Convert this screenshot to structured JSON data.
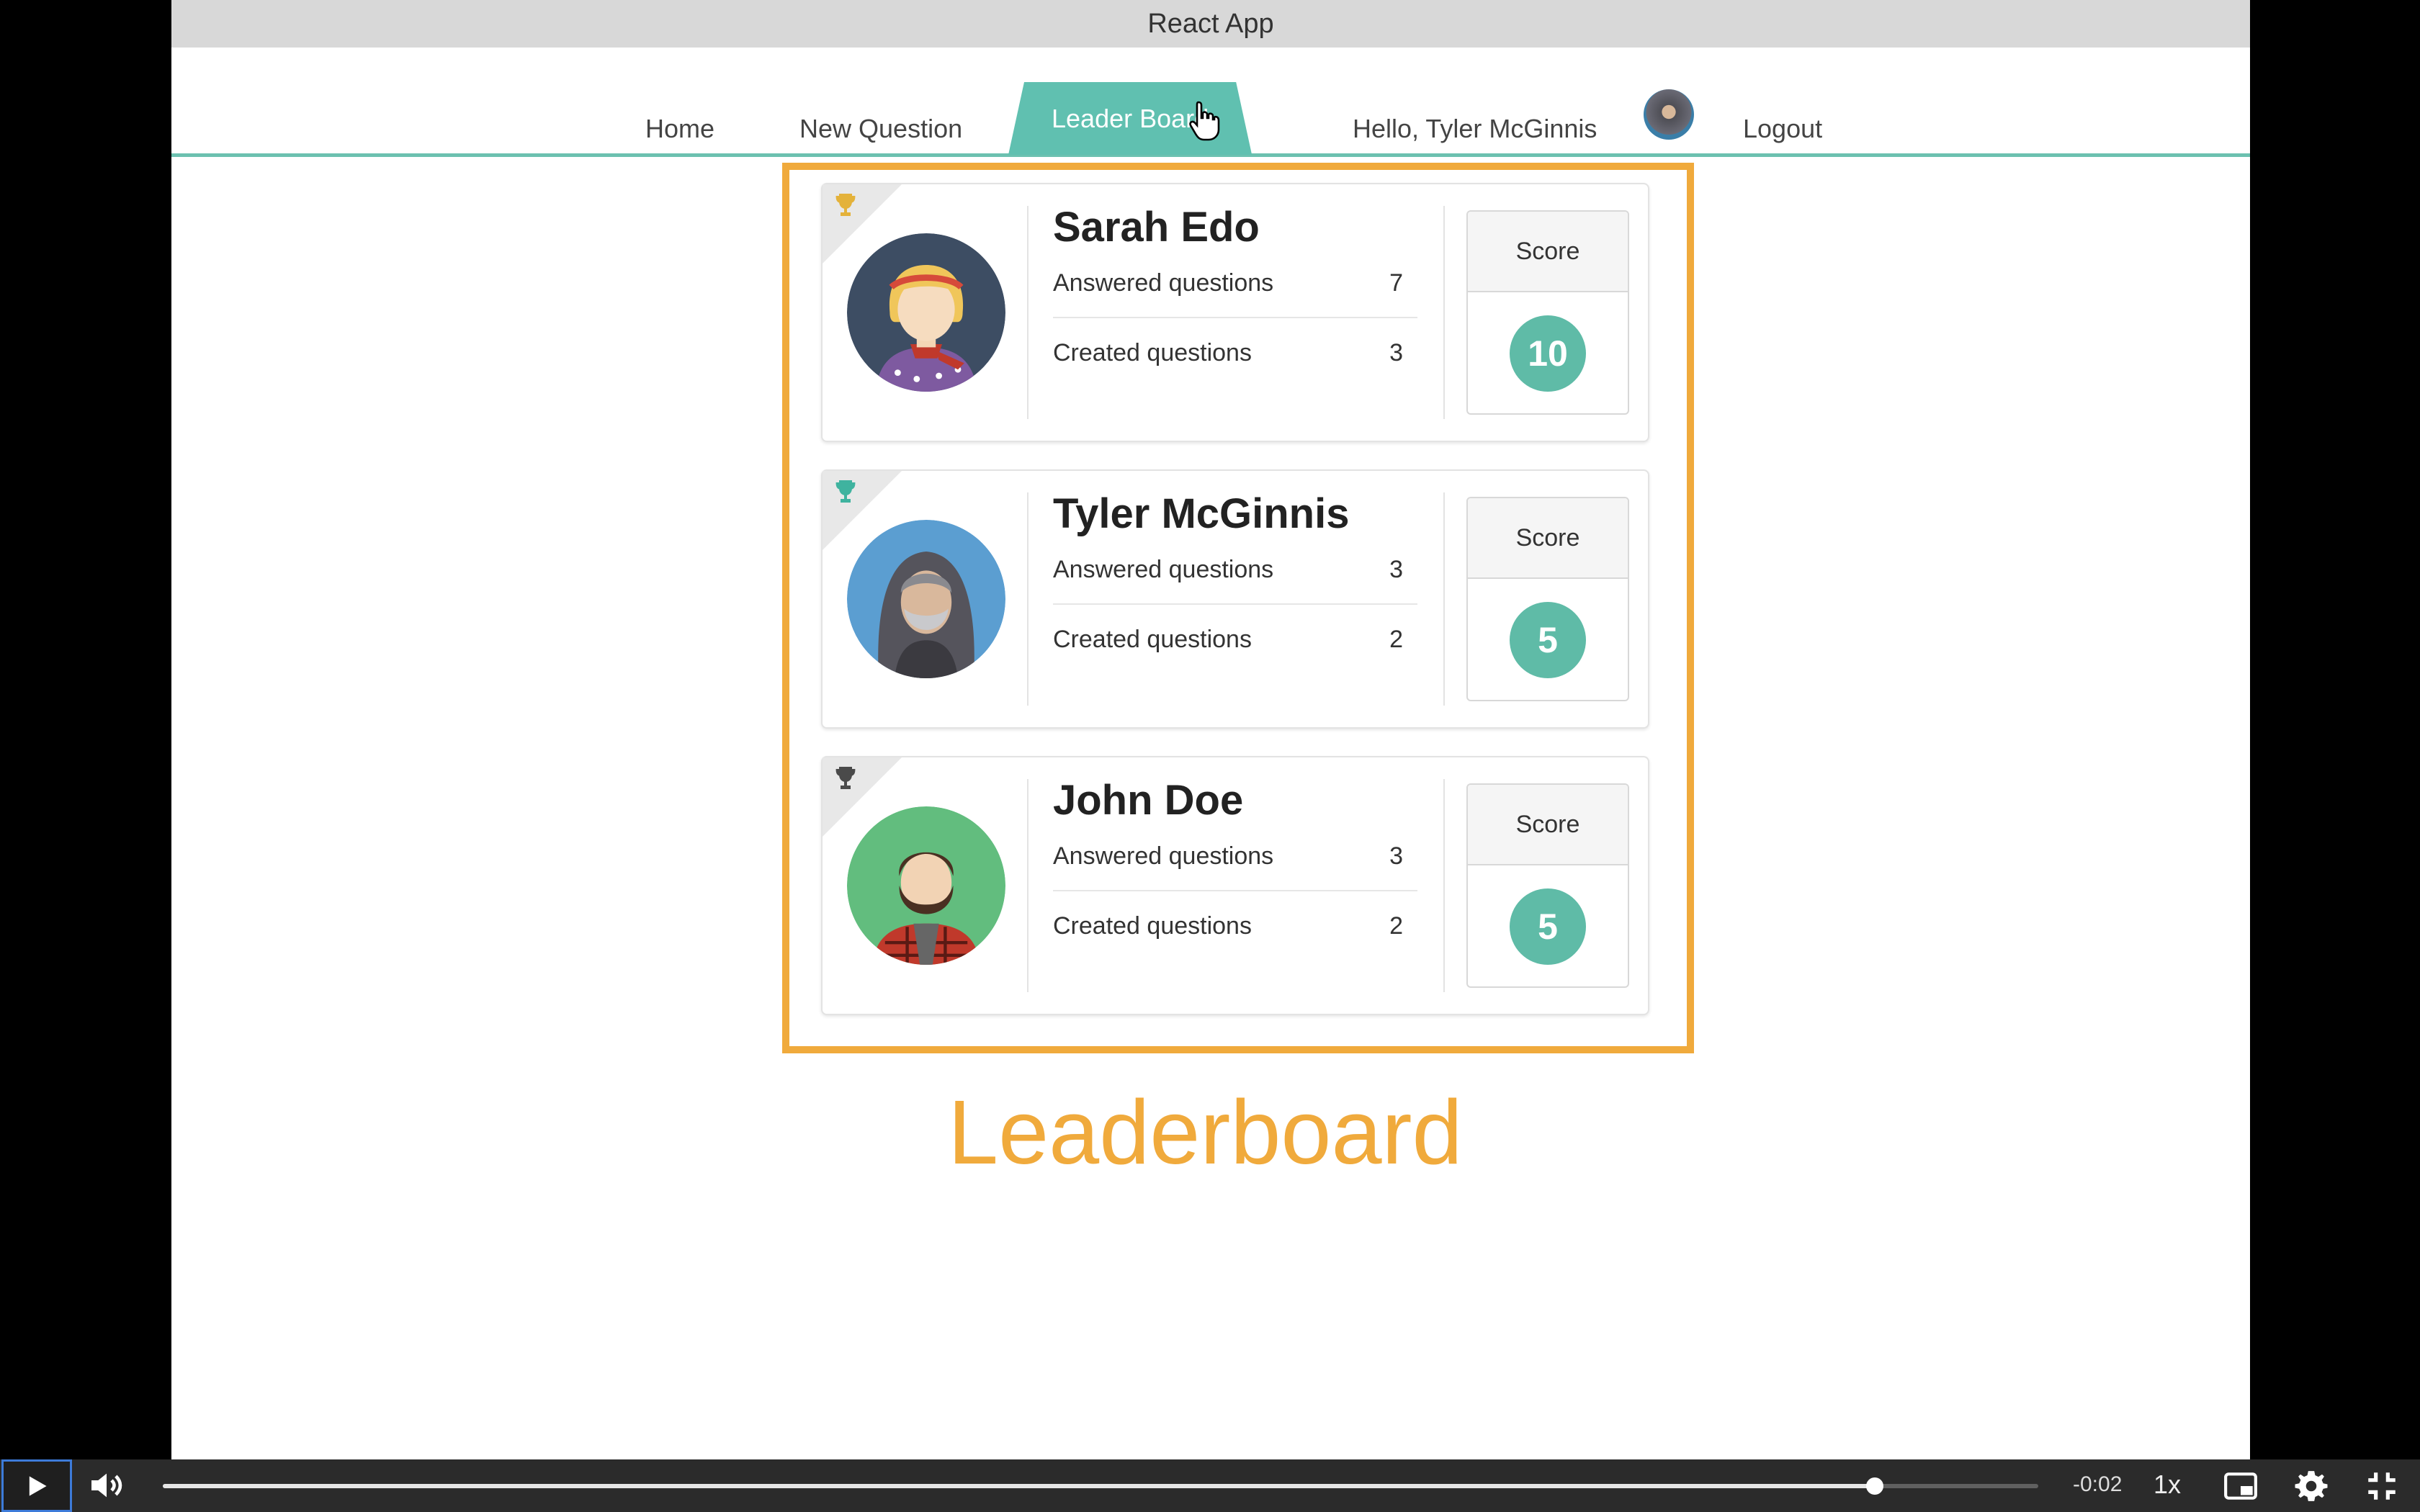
{
  "window": {
    "title": "React App"
  },
  "nav": {
    "items": [
      {
        "label": "Home"
      },
      {
        "label": "New Question"
      },
      {
        "label": "Leader Board"
      }
    ],
    "greeting": "Hello, Tyler McGinnis",
    "logout": "Logout",
    "active_tab": "Leader Board"
  },
  "leaderboard": [
    {
      "rank_trophy": "gold-trophy-icon",
      "name": "Sarah Edo",
      "answered_label": "Answered questions",
      "answered": "7",
      "created_label": "Created questions",
      "created": "3",
      "score_label": "Score",
      "score": "10",
      "avatar": "woman-avatar"
    },
    {
      "rank_trophy": "teal-trophy-icon",
      "name": "Tyler McGinnis",
      "answered_label": "Answered questions",
      "answered": "3",
      "created_label": "Created questions",
      "created": "2",
      "score_label": "Score",
      "score": "5",
      "avatar": "hooded-man-avatar"
    },
    {
      "rank_trophy": "gray-trophy-icon",
      "name": "John Doe",
      "answered_label": "Answered questions",
      "answered": "3",
      "created_label": "Created questions",
      "created": "2",
      "score_label": "Score",
      "score": "5",
      "avatar": "bearded-man-avatar"
    }
  ],
  "annotation": {
    "caption": "Leaderboard",
    "color": "#f0aa3c"
  },
  "colors": {
    "accent": "#5fbba7",
    "highlight": "#f0aa3c"
  },
  "player": {
    "time_remaining": "-0:02",
    "speed": "1x",
    "progress": 0.913
  }
}
